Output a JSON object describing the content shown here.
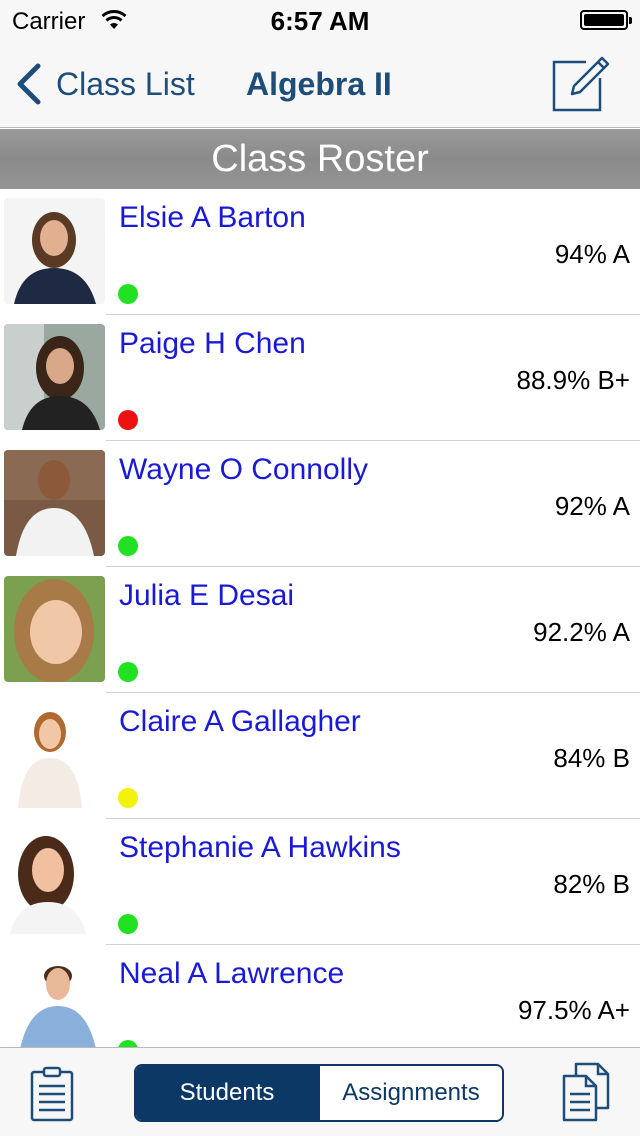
{
  "status_bar": {
    "carrier": "Carrier",
    "time": "6:57 AM"
  },
  "nav": {
    "back_label": "Class List",
    "title": "Algebra II"
  },
  "section": {
    "title": "Class Roster"
  },
  "students": [
    {
      "name": "Elsie A Barton",
      "grade": "94% A",
      "status_color": "#22e022"
    },
    {
      "name": "Paige H Chen",
      "grade": "88.9% B+",
      "status_color": "#ee1111"
    },
    {
      "name": "Wayne O Connolly",
      "grade": "92% A",
      "status_color": "#22e022"
    },
    {
      "name": "Julia E Desai",
      "grade": "92.2% A",
      "status_color": "#22e022"
    },
    {
      "name": "Claire A Gallagher",
      "grade": "84% B",
      "status_color": "#f2f20a"
    },
    {
      "name": "Stephanie A Hawkins",
      "grade": "82% B",
      "status_color": "#22e022"
    },
    {
      "name": "Neal A Lawrence",
      "grade": "97.5% A+",
      "status_color": "#22e022"
    }
  ],
  "tabbar": {
    "segments": [
      "Students",
      "Assignments"
    ],
    "active": "Students"
  },
  "icons": {
    "back": "chevron-left-icon",
    "compose": "compose-icon",
    "clipboard": "clipboard-icon",
    "documents": "documents-icon"
  },
  "colors": {
    "accent": "#1f4d7a",
    "segment": "#0c3866",
    "name_text": "#1a1ad6"
  }
}
